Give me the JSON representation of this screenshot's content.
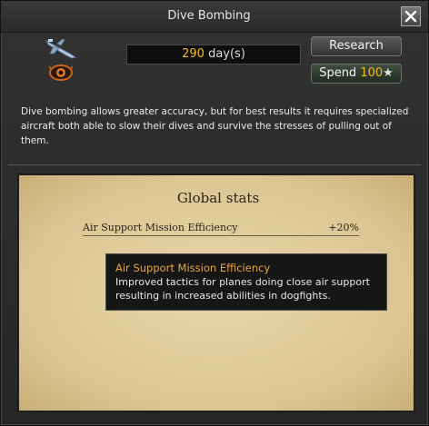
{
  "window": {
    "title": "Dive Bombing",
    "close_icon": "close-x-icon"
  },
  "header": {
    "plane_icon": "dive-bomber-plane-icon",
    "doctrine_icon": "eye-emblem-icon",
    "days_value": "290",
    "days_unit": "day(s)",
    "research_label": "Research",
    "spend_label": "Spend",
    "spend_cost": "100",
    "spend_currency_icon": "star-icon"
  },
  "description": "Dive bombing allows greater accuracy, but for best results it requires specialized aircraft both able to slow their dives and survive the stresses of pulling out of them.",
  "stats": {
    "title": "Global stats",
    "rows": [
      {
        "name": "Air Support Mission Efficiency",
        "value": "+20%"
      }
    ]
  },
  "tooltip": {
    "title": "Air Support Mission Efficiency",
    "body": "Improved tactics for planes doing close air support resulting in increased abilities in dogfights."
  },
  "colors": {
    "accent_yellow": "#f0c020",
    "tooltip_title": "#e9a640",
    "parchment": "#dcc593"
  }
}
